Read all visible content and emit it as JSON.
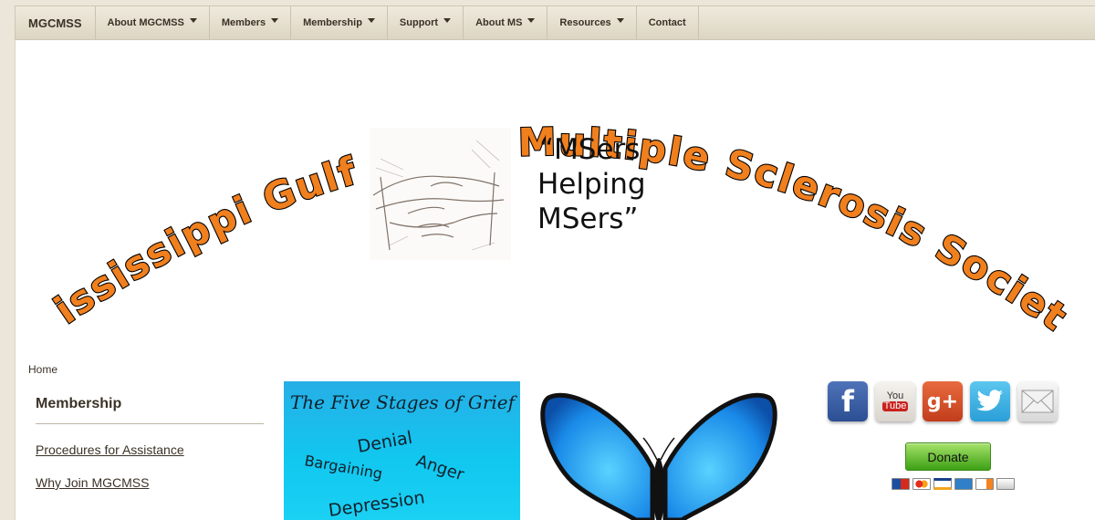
{
  "nav": {
    "brand": "MGCMSS",
    "items": [
      {
        "label": "About MGCMSS",
        "dropdown": true
      },
      {
        "label": "Members",
        "dropdown": true
      },
      {
        "label": "Membership",
        "dropdown": true
      },
      {
        "label": "Support",
        "dropdown": true
      },
      {
        "label": "About MS",
        "dropdown": true
      },
      {
        "label": "Resources",
        "dropdown": true
      },
      {
        "label": "Contact",
        "dropdown": false
      }
    ]
  },
  "banner": {
    "title": "Mississippi Gulf Coast Multiple Sclerosis Society",
    "tagline": [
      "“MSers",
      "Helping",
      "MSers”"
    ],
    "title_color": "#f07f1e"
  },
  "breadcrumb": "Home",
  "sidebar": {
    "title": "Membership",
    "links": [
      "Procedures for Assistance",
      "Why Join MGCMSS"
    ]
  },
  "grief_image": {
    "title": "The Five Stages of Grief",
    "words": [
      "Denial",
      "Anger",
      "Bargaining",
      "Depression"
    ]
  },
  "social": {
    "icons": [
      "facebook-icon",
      "youtube-icon",
      "google-plus-icon",
      "twitter-icon",
      "email-icon"
    ],
    "facebook_glyph": "f",
    "youtube_glyph_top": "You",
    "youtube_glyph_bottom": "Tube",
    "googleplus_glyph": "g+"
  },
  "donate": {
    "label": "Donate"
  },
  "payment_cards": [
    "maestro",
    "mastercard",
    "visa",
    "amex",
    "discover",
    "bank"
  ]
}
